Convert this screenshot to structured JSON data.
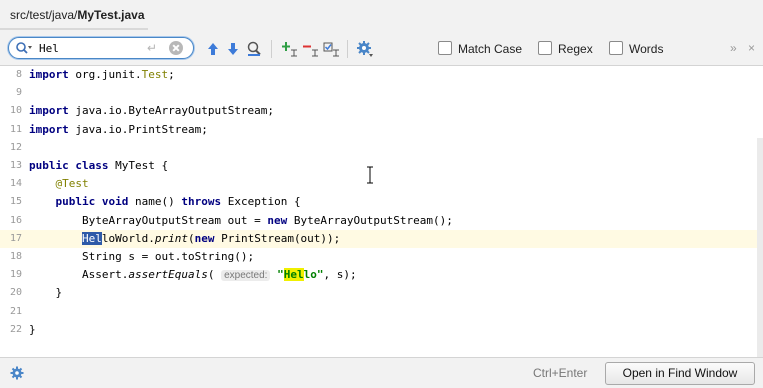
{
  "tab": {
    "path": "src/test/java/",
    "file": "MyTest.java"
  },
  "find": {
    "value": "Hel",
    "options": [
      {
        "name": "match-case",
        "label": "Match Case",
        "checked": false
      },
      {
        "name": "regex",
        "label": "Regex",
        "checked": false
      },
      {
        "name": "words",
        "label": "Words",
        "checked": false
      }
    ],
    "overflow": "»",
    "close": "×"
  },
  "editor": {
    "lines": [
      {
        "n": "8",
        "code": "import org.junit.Test;"
      },
      {
        "n": "9",
        "code": ""
      },
      {
        "n": "10",
        "code": "import java.io.ByteArrayOutputStream;"
      },
      {
        "n": "11",
        "code": "import java.io.PrintStream;"
      },
      {
        "n": "12",
        "code": ""
      },
      {
        "n": "13",
        "code": "public class MyTest {"
      },
      {
        "n": "14",
        "code": "    @Test"
      },
      {
        "n": "15",
        "code": "    public void name() throws Exception {"
      },
      {
        "n": "16",
        "code": "        ByteArrayOutputStream out = new ByteArrayOutputStream();"
      },
      {
        "n": "17",
        "code": "        HelloWorld.print(new PrintStream(out));"
      },
      {
        "n": "18",
        "code": "        String s = out.toString();"
      },
      {
        "n": "19",
        "code": "        Assert.assertEquals( expected: \"Hello\", s);"
      },
      {
        "n": "20",
        "code": "    }"
      },
      {
        "n": "21",
        "code": ""
      },
      {
        "n": "22",
        "code": "}"
      }
    ],
    "hint_label": "expected:"
  },
  "status": {
    "shortcut": "Ctrl+Enter",
    "open_button": "Open in Find Window"
  },
  "colors": {
    "keyword": "#000080",
    "annotation": "#808000",
    "string": "#008000",
    "match": "#f0f000",
    "selection": "#2e5aa8",
    "caret_line": "#fffae3"
  }
}
